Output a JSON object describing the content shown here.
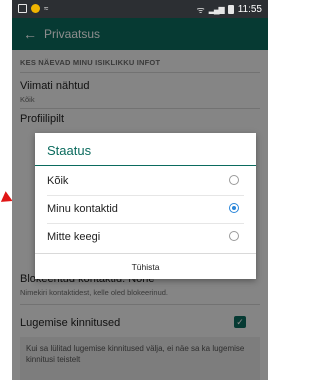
{
  "statusbar": {
    "time": "11:55"
  },
  "appbar": {
    "title": "Privaatsus"
  },
  "content": {
    "section_header": "KES NÄEVAD MINU ISIKLIKKU INFOT",
    "last_seen": {
      "title": "Viimati nähtud",
      "value": "Kõik"
    },
    "profile_photo": {
      "title": "Profiilipilt"
    },
    "blocked": {
      "title": "Blokeeritud kontaktid: None",
      "sub": "Nimekiri kontaktidest, kelle oled blokeerinud."
    },
    "read_receipts": {
      "title": "Lugemise kinnitused",
      "checked": true
    },
    "info_text": "Kui sa lülitad lugemise kinnitused välja, ei näe sa ka lugemise kinnitusi teistelt"
  },
  "dialog": {
    "title": "Staatus",
    "options": [
      {
        "label": "Kõik",
        "selected": false
      },
      {
        "label": "Minu kontaktid",
        "selected": true
      },
      {
        "label": "Mitte keegi",
        "selected": false
      }
    ],
    "cancel_label": "Tühista"
  },
  "colors": {
    "accent": "#0b6b5e",
    "radio_selected": "#2a86d9",
    "arrow": "#e01616"
  }
}
